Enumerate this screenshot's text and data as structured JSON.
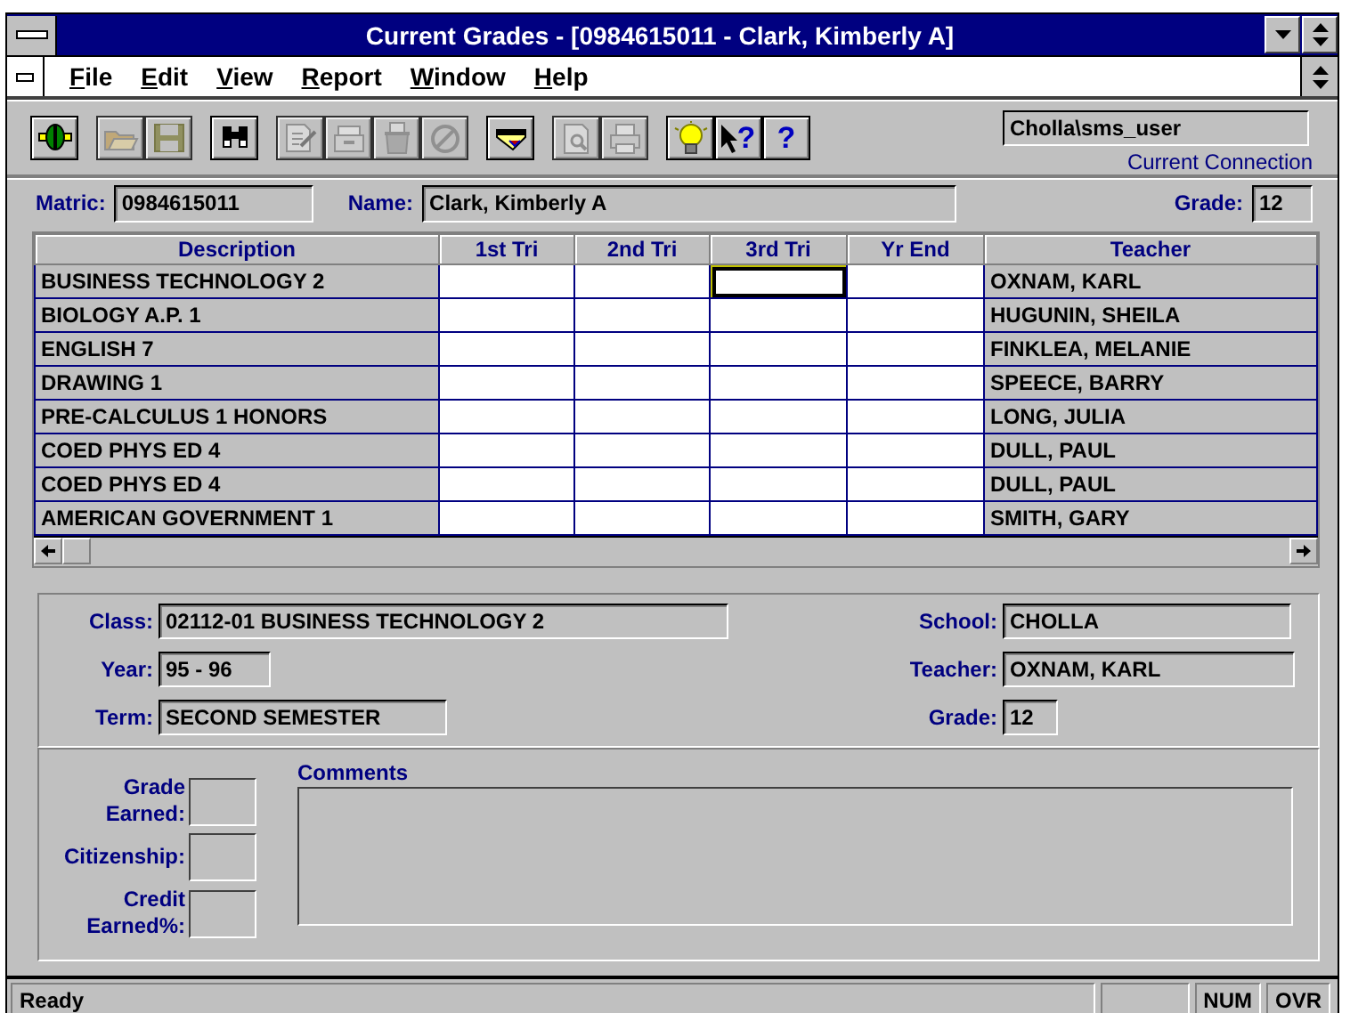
{
  "window": {
    "title": "Current Grades - [0984615011 - Clark, Kimberly A]"
  },
  "menu": [
    {
      "label": "File"
    },
    {
      "label": "Edit"
    },
    {
      "label": "View"
    },
    {
      "label": "Report"
    },
    {
      "label": "Window"
    },
    {
      "label": "Help"
    }
  ],
  "toolbar": {
    "groups": [
      {
        "buttons": [
          {
            "kind": "connect",
            "disabled": false
          }
        ]
      },
      {
        "buttons": [
          {
            "kind": "open",
            "disabled": true
          },
          {
            "kind": "save",
            "disabled": true
          }
        ]
      },
      {
        "buttons": [
          {
            "kind": "find",
            "disabled": false
          }
        ]
      },
      {
        "buttons": [
          {
            "kind": "edit",
            "disabled": true
          },
          {
            "kind": "files",
            "disabled": true
          },
          {
            "kind": "delete",
            "disabled": true
          },
          {
            "kind": "cancel",
            "disabled": true
          }
        ]
      },
      {
        "buttons": [
          {
            "kind": "card",
            "disabled": false
          }
        ]
      },
      {
        "buttons": [
          {
            "kind": "preview",
            "disabled": true
          },
          {
            "kind": "print",
            "disabled": true
          }
        ]
      },
      {
        "buttons": [
          {
            "kind": "tip",
            "disabled": false
          },
          {
            "kind": "context_help",
            "disabled": false,
            "label": "?"
          },
          {
            "kind": "help",
            "disabled": false,
            "label": "?"
          }
        ]
      }
    ],
    "connection": {
      "value": "Cholla\\sms_user",
      "caption": "Current Connection"
    }
  },
  "student": {
    "matric_label": "Matric:",
    "matric": "0984615011",
    "name_label": "Name:",
    "name": "Clark, Kimberly A",
    "grade_label": "Grade:",
    "grade": "12"
  },
  "grid": {
    "columns": [
      "Description",
      "1st Tri",
      "2nd Tri",
      "3rd Tri",
      "Yr End",
      "Teacher"
    ],
    "rows": [
      {
        "description": "BUSINESS TECHNOLOGY 2",
        "teacher": "OXNAM, KARL",
        "cells": [
          {
            "focused": false
          },
          {
            "focused": false
          },
          {
            "focused": true
          },
          {
            "focused": false
          }
        ]
      },
      {
        "description": "BIOLOGY A.P. 1",
        "teacher": "HUGUNIN, SHEILA",
        "cells": [
          {
            "focused": false
          },
          {
            "focused": false
          },
          {
            "focused": false
          },
          {
            "focused": false
          }
        ]
      },
      {
        "description": "ENGLISH 7",
        "teacher": "FINKLEA, MELANIE",
        "cells": [
          {
            "focused": false
          },
          {
            "focused": false
          },
          {
            "focused": false
          },
          {
            "focused": false
          }
        ]
      },
      {
        "description": "DRAWING 1",
        "teacher": "SPEECE, BARRY",
        "cells": [
          {
            "focused": false
          },
          {
            "focused": false
          },
          {
            "focused": false
          },
          {
            "focused": false
          }
        ]
      },
      {
        "description": "PRE-CALCULUS 1 HONORS",
        "teacher": "LONG, JULIA",
        "cells": [
          {
            "focused": false
          },
          {
            "focused": false
          },
          {
            "focused": false
          },
          {
            "focused": false
          }
        ]
      },
      {
        "description": "COED PHYS ED 4",
        "teacher": "DULL, PAUL",
        "cells": [
          {
            "focused": false
          },
          {
            "focused": false
          },
          {
            "focused": false
          },
          {
            "focused": false
          }
        ]
      },
      {
        "description": "COED PHYS ED 4",
        "teacher": "DULL, PAUL",
        "cells": [
          {
            "focused": false
          },
          {
            "focused": false
          },
          {
            "focused": false
          },
          {
            "focused": false
          }
        ]
      },
      {
        "description": "AMERICAN GOVERNMENT 1",
        "teacher": "SMITH, GARY",
        "cells": [
          {
            "focused": false
          },
          {
            "focused": false
          },
          {
            "focused": false
          },
          {
            "focused": false
          }
        ]
      }
    ]
  },
  "class_details": {
    "left": [
      {
        "label": "Class:",
        "value": "02112-01  BUSINESS TECHNOLOGY 2"
      },
      {
        "label": "Year:",
        "value": "95 - 96"
      },
      {
        "label": "Term:",
        "value": "SECOND SEMESTER"
      }
    ],
    "right": [
      {
        "label": "School:",
        "value": "CHOLLA"
      },
      {
        "label": "Teacher:",
        "value": "OXNAM, KARL"
      },
      {
        "label": "Grade:",
        "value": "12"
      }
    ]
  },
  "entry": {
    "fields": [
      {
        "label": "Grade Earned:"
      },
      {
        "label": "Citizenship:"
      },
      {
        "label": "Credit Earned%:"
      }
    ],
    "comments_label": "Comments"
  },
  "status_bar": {
    "message": "Ready",
    "indicators": [
      "NUM",
      "OVR"
    ]
  }
}
